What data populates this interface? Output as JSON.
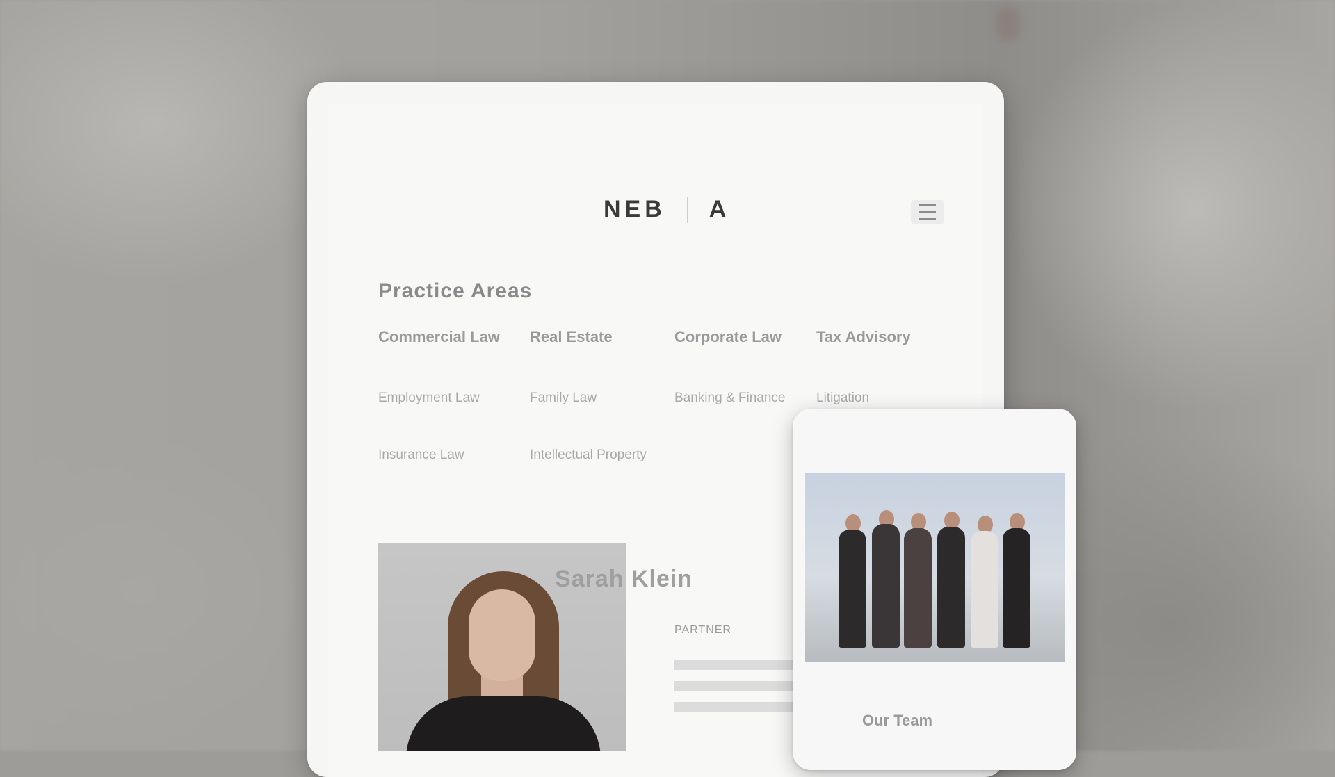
{
  "scene": {
    "background_color": "#9e9c99"
  },
  "desktop_site": {
    "logo_left": "NEB",
    "logo_right": "A",
    "menu_icon": "hamburger-menu-icon",
    "section_title": "Practice Areas",
    "practice_items": [
      {
        "text": "Commercial Law",
        "strong": true
      },
      {
        "text": "Real Estate",
        "strong": true
      },
      {
        "text": "Corporate Law",
        "strong": true
      },
      {
        "text": "Tax Advisory",
        "strong": true
      },
      {
        "text": "Employment Law",
        "strong": false
      },
      {
        "text": "Family Law",
        "strong": false
      },
      {
        "text": "Banking & Finance",
        "strong": false
      },
      {
        "text": "Litigation",
        "strong": false
      },
      {
        "text": "Insurance Law",
        "strong": false
      },
      {
        "text": "Intellectual Property",
        "strong": false
      }
    ],
    "profile_name": "Sarah Klein",
    "profile_role": "PARTNER"
  },
  "mobile_site": {
    "team_photo_label": "team-photo",
    "caption": "Our Team"
  }
}
